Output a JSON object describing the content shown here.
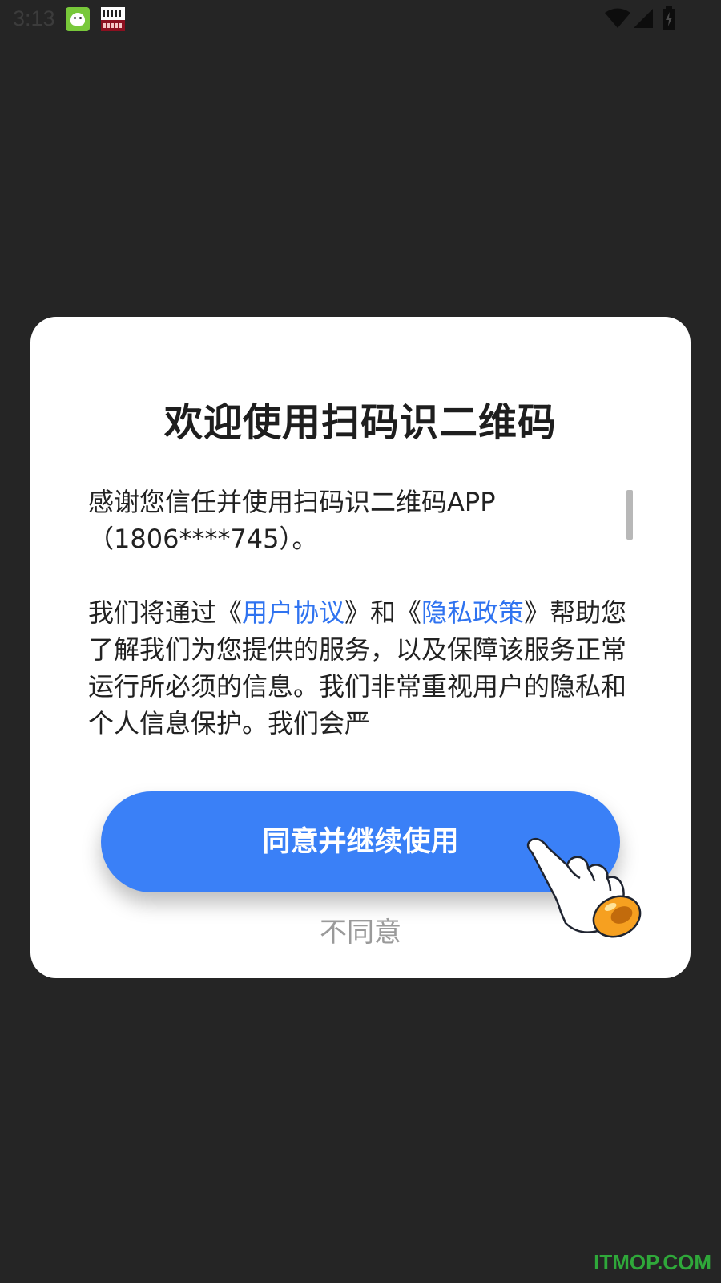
{
  "status_bar": {
    "time": "3:13",
    "notification_icons": [
      "app-mascot-icon",
      "news-app-icon"
    ],
    "system_icons": [
      "wifi-icon",
      "signal-icon",
      "battery-charging-icon"
    ]
  },
  "dialog": {
    "title": "欢迎使用扫码识二维码",
    "paragraph1": "感谢您信任并使用扫码识二维码APP（1806****745）。",
    "paragraph2": {
      "before": "我们将通过《",
      "link1": "用户协议",
      "middle": "》和《",
      "link2": "隐私政策",
      "after": "》帮助您了解我们为您提供的服务，以及保障该服务正常运行所必须的信息。我们非常重视用户的隐私和个人信息保护。我们会严"
    },
    "agree_button": "同意并继续使用",
    "disagree_link": "不同意"
  },
  "watermark": "ITMOP.COM",
  "colors": {
    "background": "#252525",
    "accent": "#3a80f7",
    "link": "#2f73f0",
    "secondary_text": "#9a9a9a"
  }
}
